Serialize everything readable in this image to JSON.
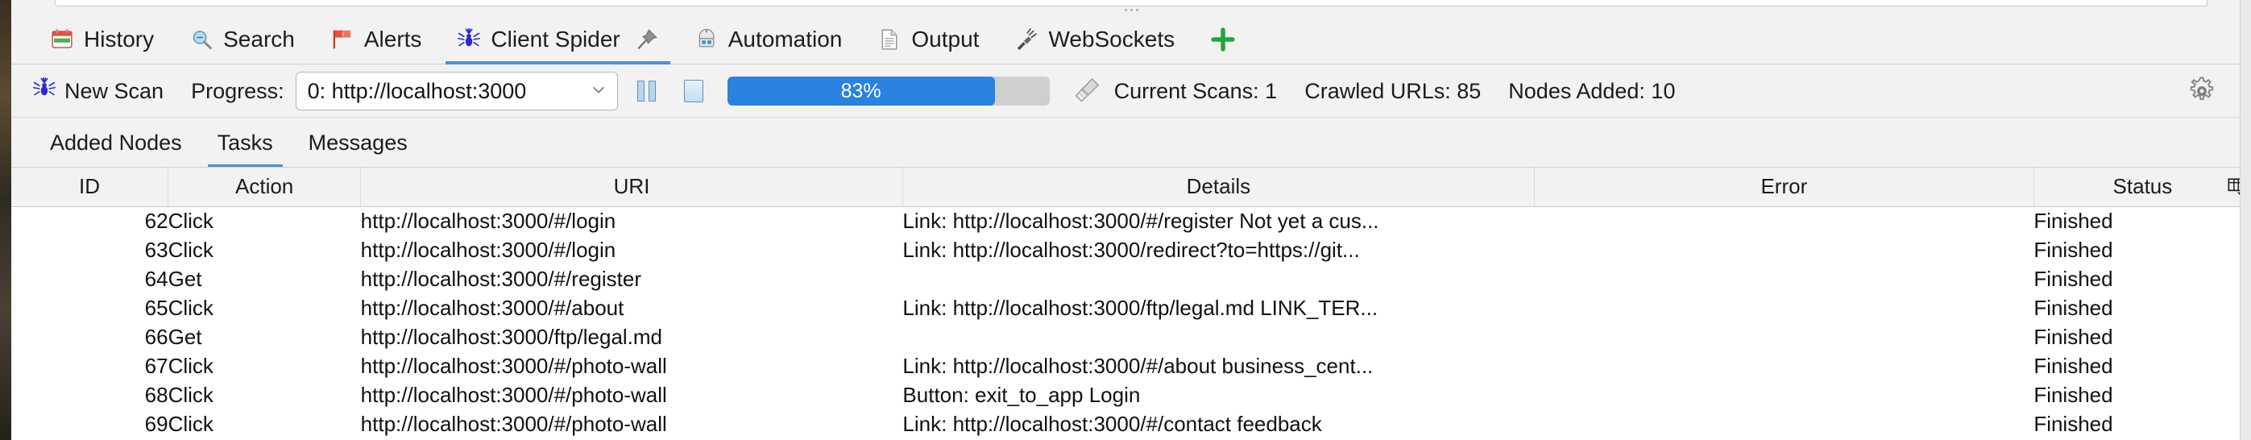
{
  "window": {
    "main_tabs": [
      {
        "label": "History",
        "icon": "history-calendar-icon",
        "active": false,
        "pinned": false
      },
      {
        "label": "Search",
        "icon": "search-magnifier-icon",
        "active": false,
        "pinned": false
      },
      {
        "label": "Alerts",
        "icon": "alerts-flag-icon",
        "active": false,
        "pinned": false
      },
      {
        "label": "Client Spider",
        "icon": "spider-icon",
        "active": true,
        "pinned": true
      },
      {
        "label": "Automation",
        "icon": "automation-robot-icon",
        "active": false,
        "pinned": false
      },
      {
        "label": "Output",
        "icon": "output-document-icon",
        "active": false,
        "pinned": false
      },
      {
        "label": "WebSockets",
        "icon": "websockets-plug-icon",
        "active": false,
        "pinned": false
      }
    ],
    "add_tab_label": "+"
  },
  "toolbar": {
    "new_scan_label": "New Scan",
    "new_scan_icon": "spider-icon",
    "progress_label": "Progress:",
    "scan_select": {
      "value": "0: http://localhost:3000",
      "options": [
        "0: http://localhost:3000"
      ]
    },
    "pause_button_icon": "pause-icon",
    "stop_button_icon": "stop-icon",
    "progress": {
      "percent": 83,
      "text": "83%",
      "fill_color": "#2a82e0",
      "track_color": "#cfcfcf"
    },
    "broom_icon": "broom-clear-icon",
    "stats": [
      "Current Scans: 1",
      "Crawled URLs: 85",
      "Nodes Added: 10"
    ],
    "options_icon": "gear-icon"
  },
  "sub_tabs": [
    {
      "label": "Added Nodes",
      "active": false
    },
    {
      "label": "Tasks",
      "active": true
    },
    {
      "label": "Messages",
      "active": false
    }
  ],
  "table": {
    "columns": [
      "ID",
      "Action",
      "URI",
      "Details",
      "Error",
      "Status"
    ],
    "column_config_icon": "column-settings-icon",
    "rows": [
      {
        "id": "62",
        "action": "Click",
        "uri": "http://localhost:3000/#/login",
        "details": "Link: http://localhost:3000/#/register Not yet a cus...",
        "error": "",
        "status": "Finished"
      },
      {
        "id": "63",
        "action": "Click",
        "uri": "http://localhost:3000/#/login",
        "details": "Link: http://localhost:3000/redirect?to=https://git...",
        "error": "",
        "status": "Finished"
      },
      {
        "id": "64",
        "action": "Get",
        "uri": "http://localhost:3000/#/register",
        "details": "",
        "error": "",
        "status": "Finished"
      },
      {
        "id": "65",
        "action": "Click",
        "uri": "http://localhost:3000/#/about",
        "details": "Link: http://localhost:3000/ftp/legal.md LINK_TER...",
        "error": "",
        "status": "Finished"
      },
      {
        "id": "66",
        "action": "Get",
        "uri": "http://localhost:3000/ftp/legal.md",
        "details": "",
        "error": "",
        "status": "Finished"
      },
      {
        "id": "67",
        "action": "Click",
        "uri": "http://localhost:3000/#/photo-wall",
        "details": "Link: http://localhost:3000/#/about  business_cent...",
        "error": "",
        "status": "Finished"
      },
      {
        "id": "68",
        "action": "Click",
        "uri": "http://localhost:3000/#/photo-wall",
        "details": "Button:  exit_to_app  Login",
        "error": "",
        "status": "Finished"
      },
      {
        "id": "69",
        "action": "Click",
        "uri": "http://localhost:3000/#/photo-wall",
        "details": "Link: http://localhost:3000/#/contact  feedback",
        "error": "",
        "status": "Finished"
      }
    ]
  }
}
